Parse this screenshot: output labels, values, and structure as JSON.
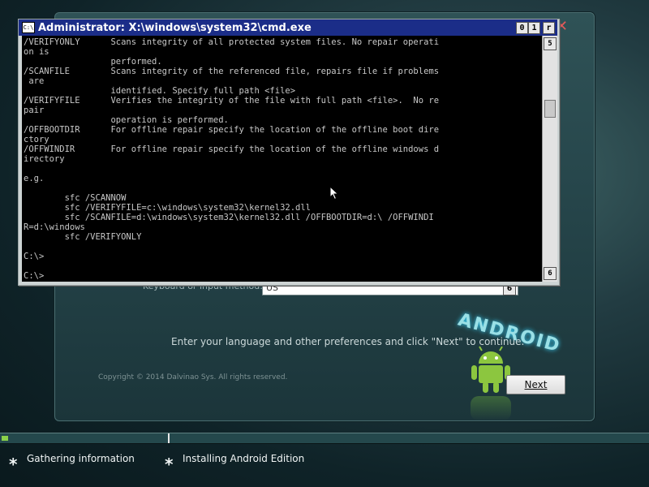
{
  "setup": {
    "close_glyph": "✕",
    "language_label": "Keyboard or input method:",
    "language_value": "US",
    "dropdown_glyph": "6",
    "android_text": "ANDROID",
    "instruction": "Enter your language and other preferences and click \"Next\" to continue.",
    "copyright": "Copyright © 2014 Dalvinao Sys. All rights reserved.",
    "next_label": "Next"
  },
  "progress": {
    "fill_fraction": 0.01,
    "steps": [
      {
        "label": "Gathering information",
        "star": "*"
      },
      {
        "label": "Installing Android Edition",
        "star": "*"
      }
    ]
  },
  "cmd": {
    "title": "Administrator: X:\\windows\\system32\\cmd.exe",
    "icon_label": "C:\\",
    "min_glyph": "0",
    "max_glyph": "1",
    "close_glyph": "r",
    "scroll_up_glyph": "5",
    "scroll_down_glyph": "6",
    "output": "/VERIFYONLY      Scans integrity of all protected system files. No repair operati\non is\n                 performed.\n/SCANFILE        Scans integrity of the referenced file, repairs file if problems\n are\n                 identified. Specify full path <file>\n/VERIFYFILE      Verifies the integrity of the file with full path <file>.  No re\npair\n                 operation is performed.\n/OFFBOOTDIR      For offline repair specify the location of the offline boot dire\nctory\n/OFFWINDIR       For offline repair specify the location of the offline windows d\nirectory\n\ne.g.\n\n        sfc /SCANNOW\n        sfc /VERIFYFILE=c:\\windows\\system32\\kernel32.dll\n        sfc /SCANFILE=d:\\windows\\system32\\kernel32.dll /OFFBOOTDIR=d:\\ /OFFWINDI\nR=d:\\windows\n        sfc /VERIFYONLY\n\nC:\\>\n\nC:\\>"
  },
  "colors": {
    "cmd_title_bar": "#1b2d88",
    "progress_fill": "#8ad14a",
    "android_green": "#8cc63f"
  }
}
